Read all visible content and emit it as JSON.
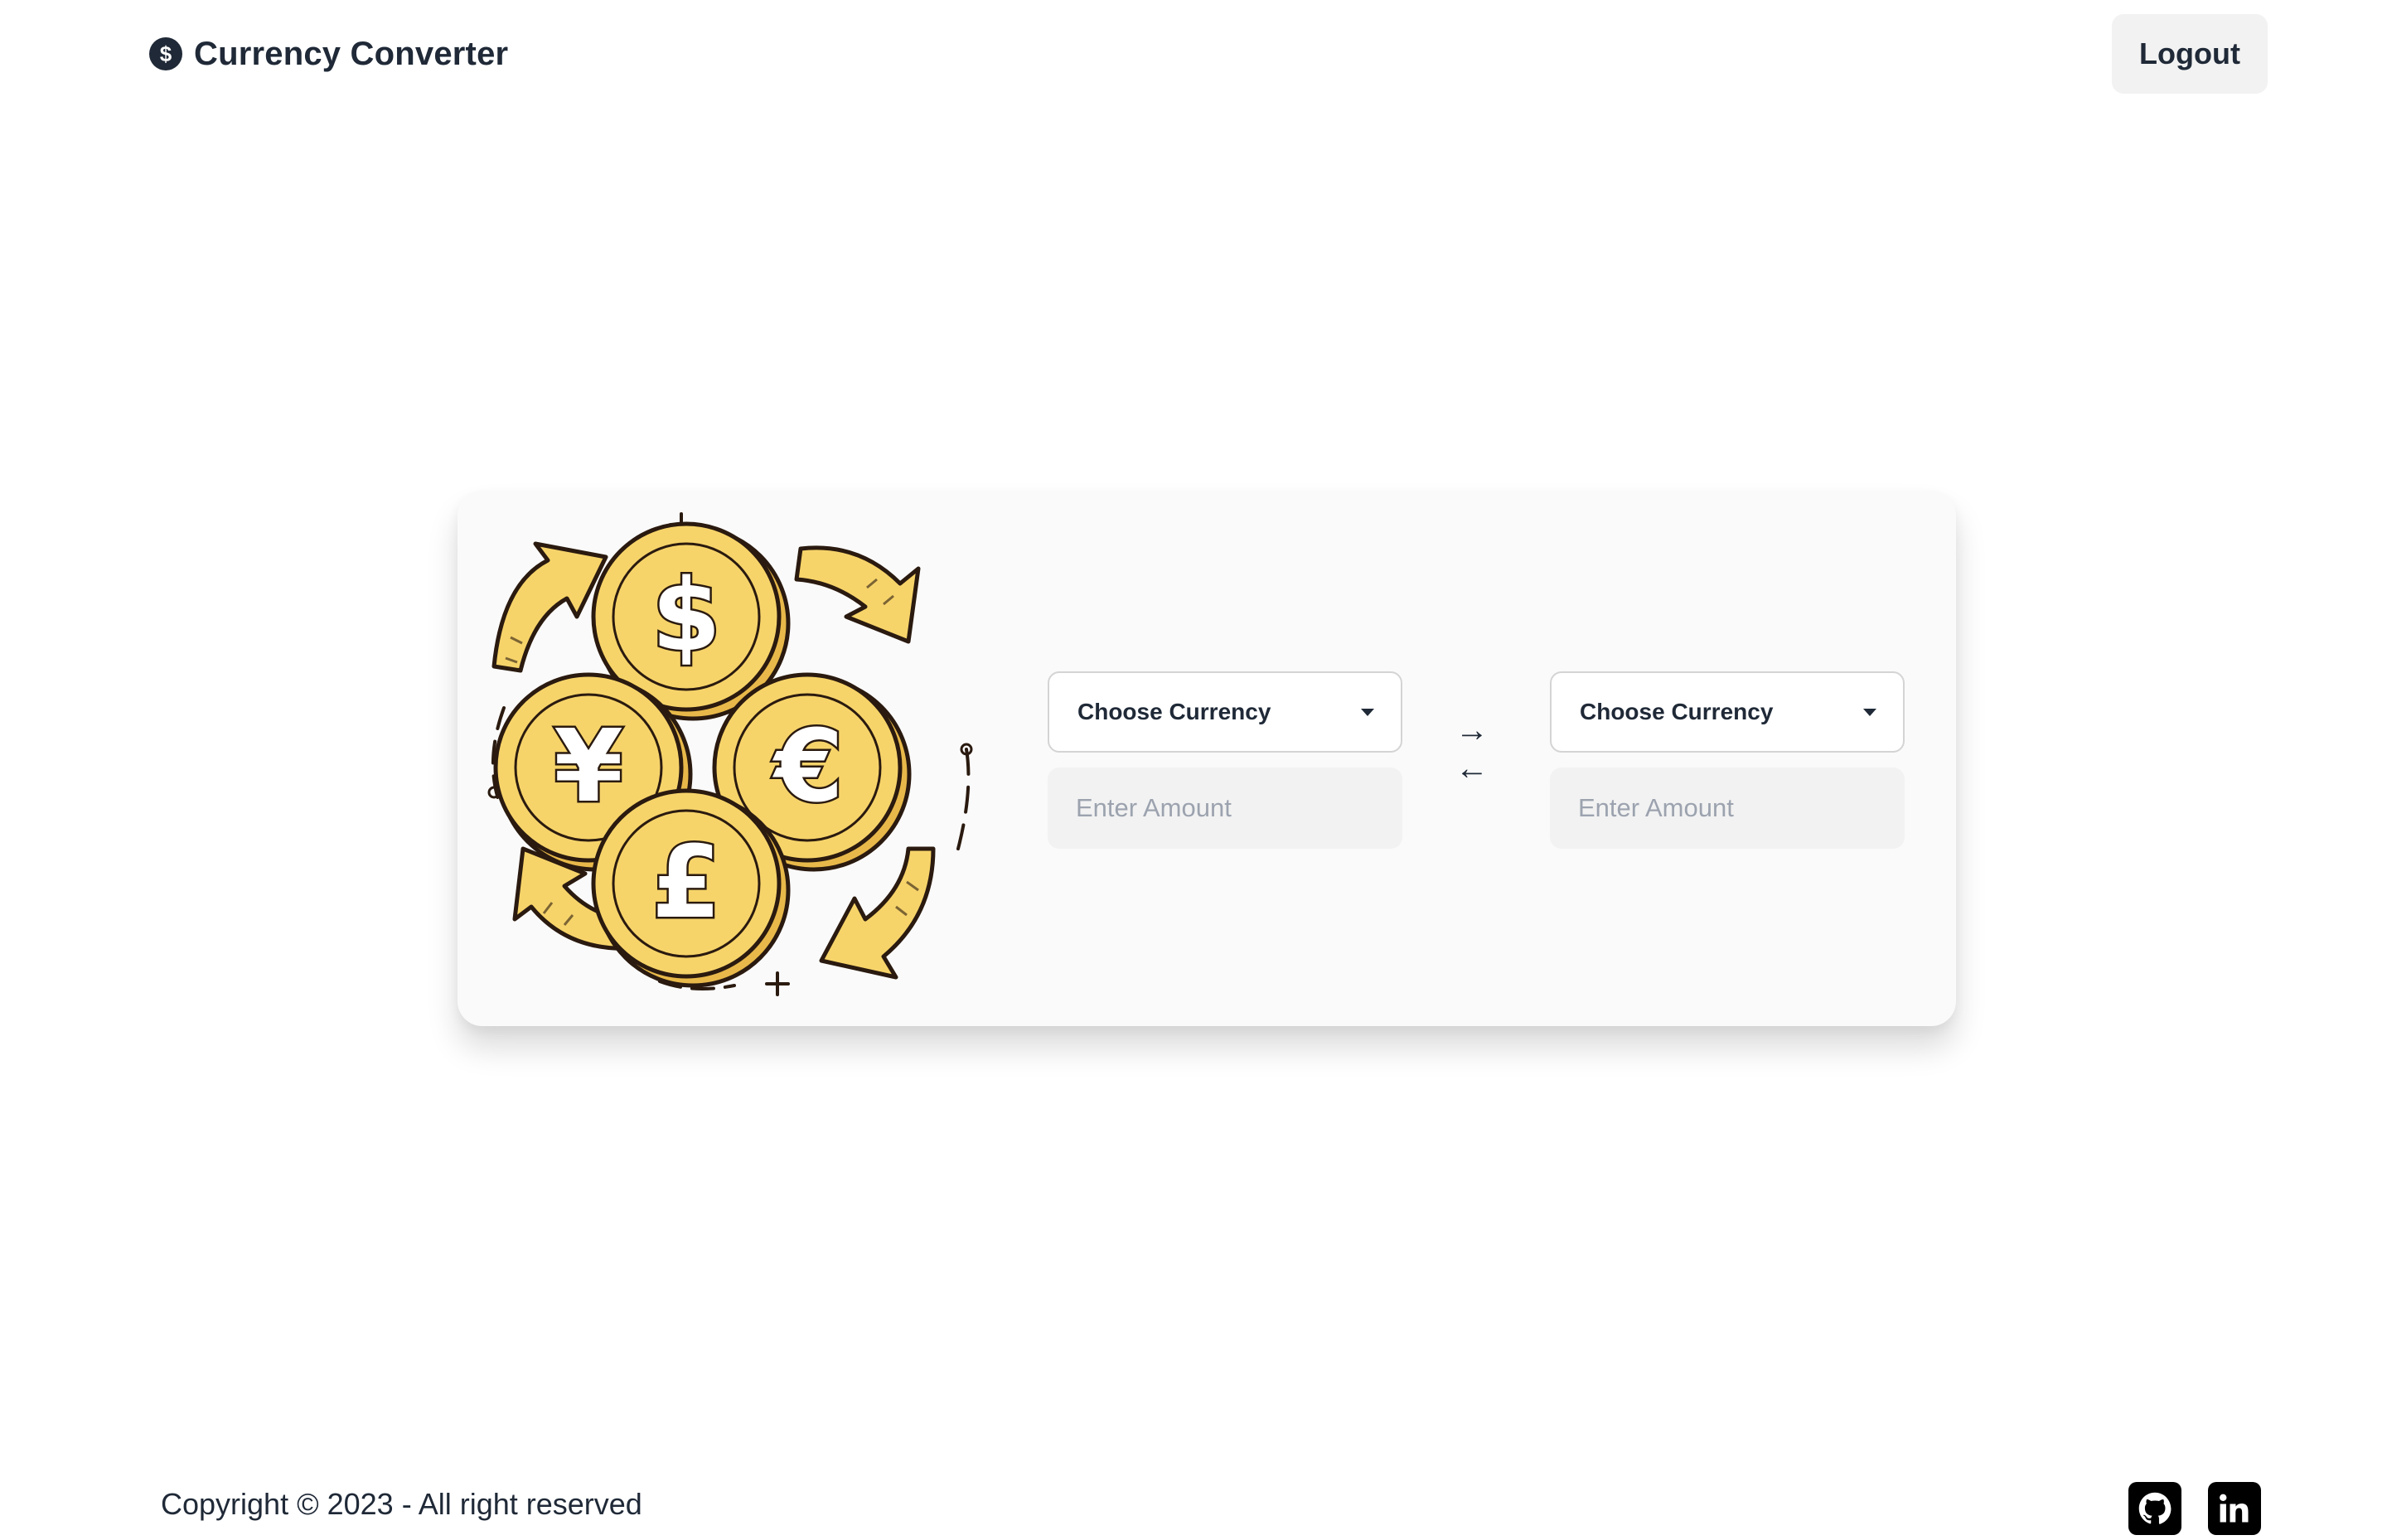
{
  "header": {
    "brand_icon": "dollar-coin-icon",
    "title": "Currency Converter",
    "logout_label": "Logout"
  },
  "converter": {
    "illustration": "currency-exchange-coins-illustration",
    "from": {
      "select_label": "Choose Currency",
      "amount_placeholder": "Enter Amount",
      "amount_value": ""
    },
    "swap_icons": {
      "top": "→",
      "bottom": "←"
    },
    "to": {
      "select_label": "Choose Currency",
      "amount_placeholder": "Enter Amount",
      "amount_value": ""
    }
  },
  "footer": {
    "copyright": "Copyright © 2023 - All right reserved",
    "social": [
      {
        "name": "github-icon"
      },
      {
        "name": "linkedin-icon"
      }
    ]
  },
  "colors": {
    "text": "#1f2937",
    "coin_fill": "#f7d46a",
    "coin_outline": "#2a1a0f",
    "card_bg": "#fafafa",
    "input_bg": "#f2f2f2"
  }
}
